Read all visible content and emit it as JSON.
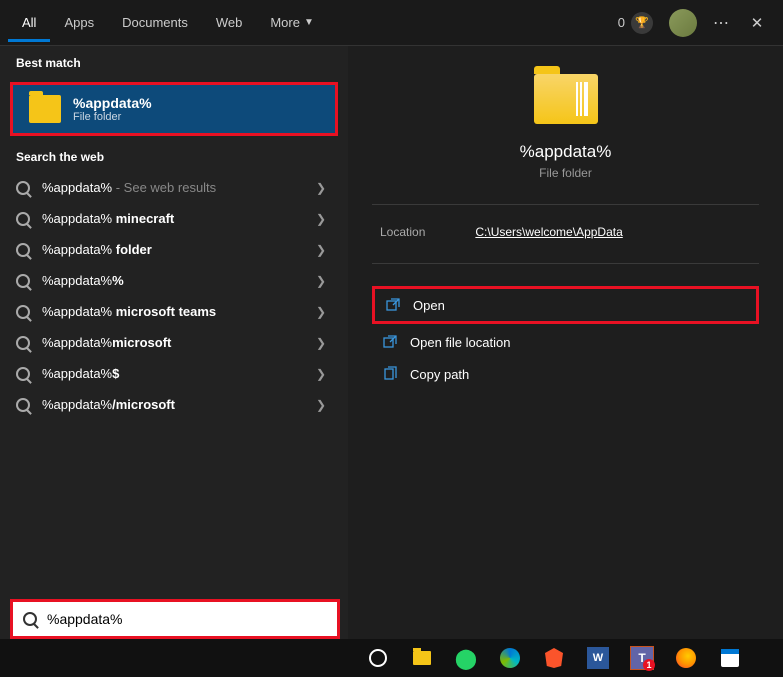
{
  "header": {
    "tabs": [
      {
        "label": "All",
        "active": true
      },
      {
        "label": "Apps"
      },
      {
        "label": "Documents"
      },
      {
        "label": "Web"
      },
      {
        "label": "More"
      }
    ],
    "reward_count": "0"
  },
  "sections": {
    "best_match": "Best match",
    "search_web": "Search the web"
  },
  "best_match_item": {
    "title": "%appdata%",
    "subtitle": "File folder"
  },
  "web_results": [
    {
      "prefix": "%appdata%",
      "suffix": "",
      "hint": " - See web results"
    },
    {
      "prefix": "%appdata% ",
      "suffix": "minecraft",
      "hint": ""
    },
    {
      "prefix": "%appdata% ",
      "suffix": "folder",
      "hint": ""
    },
    {
      "prefix": "%appdata%",
      "suffix": "%",
      "hint": ""
    },
    {
      "prefix": "%appdata% ",
      "suffix": "microsoft teams",
      "hint": ""
    },
    {
      "prefix": "%appdata%",
      "suffix": "microsoft",
      "hint": ""
    },
    {
      "prefix": "%appdata%",
      "suffix": "$",
      "hint": ""
    },
    {
      "prefix": "%appdata%",
      "suffix": "/microsoft",
      "hint": ""
    }
  ],
  "detail": {
    "title": "%appdata%",
    "subtitle": "File folder",
    "location_label": "Location",
    "location_value": "C:\\Users\\welcome\\AppData",
    "actions": [
      {
        "label": "Open",
        "icon": "open",
        "highlighted": true
      },
      {
        "label": "Open file location",
        "icon": "open",
        "highlighted": false
      },
      {
        "label": "Copy path",
        "icon": "copy",
        "highlighted": false
      }
    ]
  },
  "search_input": {
    "value": "%appdata%"
  }
}
